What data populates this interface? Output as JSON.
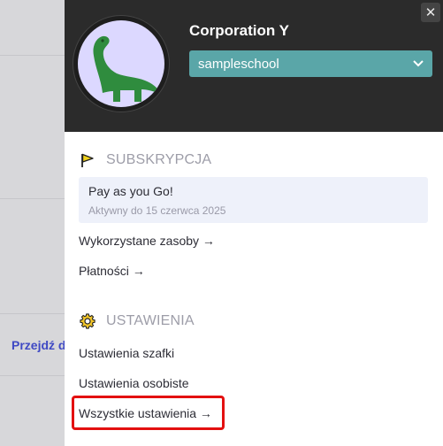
{
  "background": {
    "link_text": "Przejdź d"
  },
  "header": {
    "organization_name": "Corporation Y",
    "school_select": {
      "selected": "sampleschool"
    },
    "close_icon": "close-icon",
    "avatar_icon": "dinosaur-icon"
  },
  "subscription": {
    "heading": "SUBSKRYPCJA",
    "icon": "flag-icon",
    "plan_name": "Pay as you Go!",
    "plan_expiry": "Aktywny do 15 czerwca 2025",
    "resources_link": "Wykorzystane zasoby →",
    "payments_link": "Płatności →"
  },
  "settings": {
    "heading": "USTAWIENIA",
    "icon": "gear-icon",
    "locker_link": "Ustawienia szafki",
    "personal_link": "Ustawienia osobiste",
    "all_link": "Wszystkie ustawienia →"
  },
  "colors": {
    "header_bg": "#2b2b2b",
    "select_bg": "#5aa6a8",
    "highlight_border": "#e31010",
    "plan_box_bg": "#eef1fa"
  }
}
